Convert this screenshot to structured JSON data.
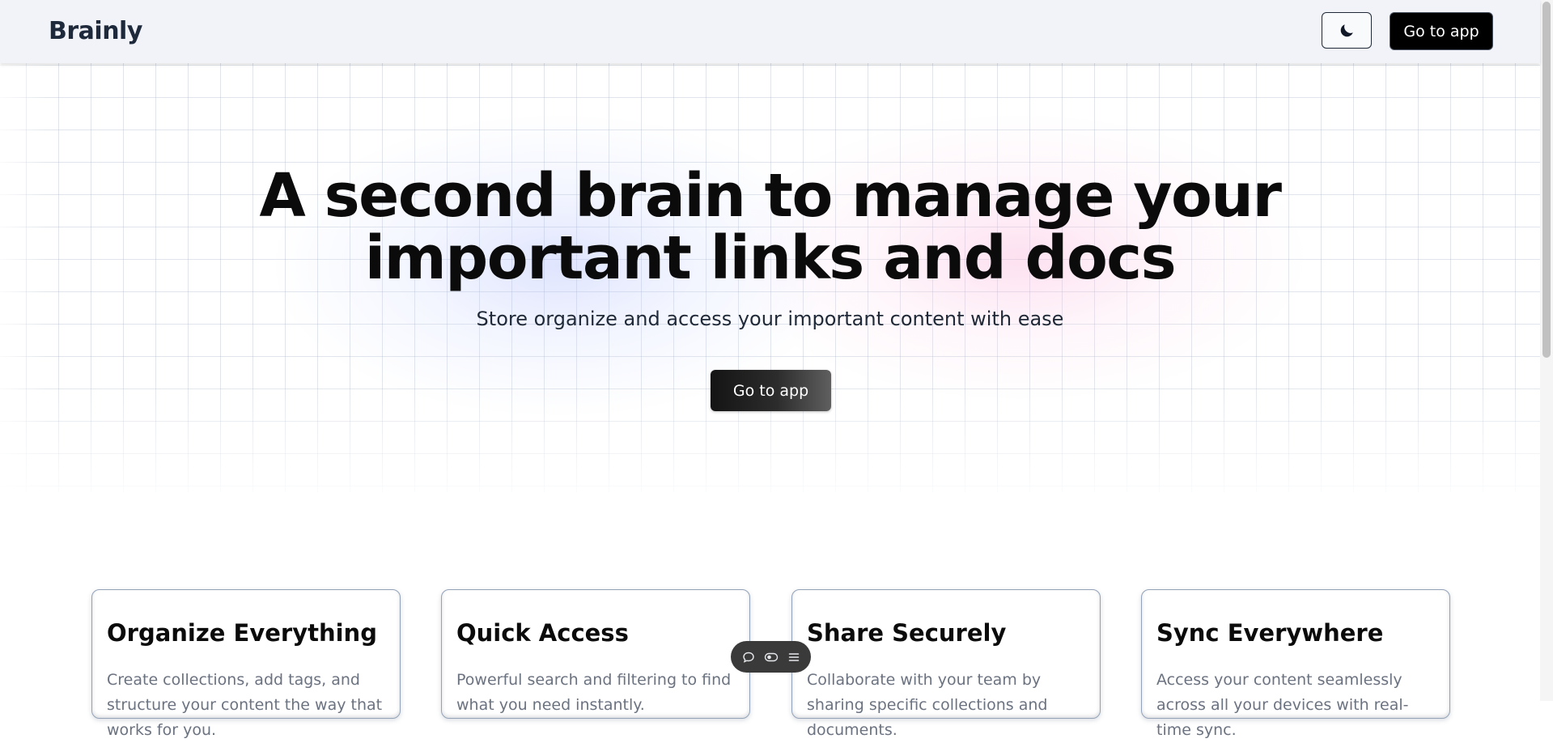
{
  "header": {
    "brand": "Brainly",
    "theme_toggle_icon": "moon-icon",
    "cta_label": "Go to app"
  },
  "hero": {
    "title_line1": "A second brain to manage your",
    "title_line2": "important links and docs",
    "subtitle": "Store organize and access your important content with ease",
    "cta_label": "Go to app"
  },
  "features": [
    {
      "title": "Organize Everything",
      "description": "Create collections, add tags, and structure your content the way that works for you."
    },
    {
      "title": "Quick Access",
      "description": "Powerful search and filtering to find what you need instantly."
    },
    {
      "title": "Share Securely",
      "description": "Collaborate with your team by sharing specific collections and documents."
    },
    {
      "title": "Sync Everywhere",
      "description": "Access your content seamlessly across all your devices with real-time sync."
    }
  ],
  "floating_toolbar": {
    "icons": [
      "comment-icon",
      "toggle-icon",
      "menu-icon"
    ]
  },
  "colors": {
    "navbar_bg": "#f1f3f8",
    "primary_button": "#000000",
    "card_border": "#94a3b8",
    "glow_blue": "#c7d2fe",
    "glow_pink": "#fbcfe8"
  }
}
